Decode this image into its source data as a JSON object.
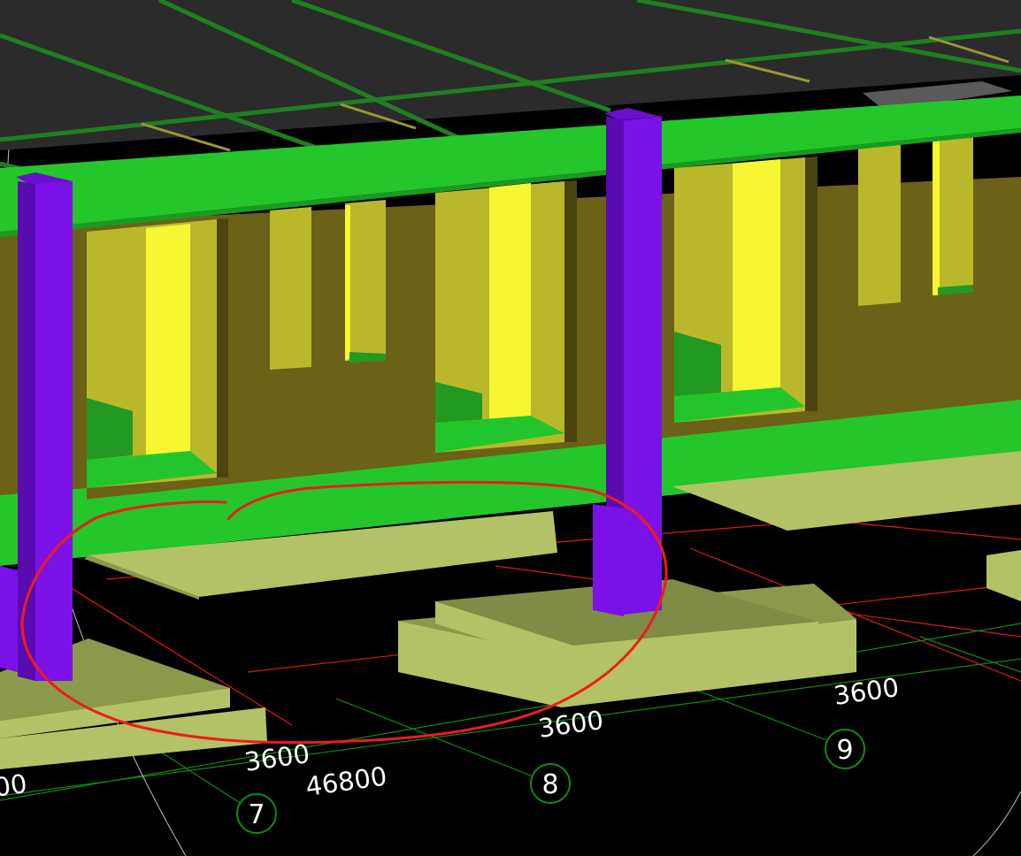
{
  "dimensions": {
    "bay_7_8": "3600",
    "bay_8_9": "3600",
    "bay_9_10": "3600",
    "total": "46800",
    "cut_left": "00"
  },
  "axis_bubbles": {
    "a7": "7",
    "a8": "8",
    "a9": "9"
  },
  "colors": {
    "background": "#000000",
    "slab": "#2c2c2c",
    "beam": "#22c62c",
    "column": "#7a12e8",
    "wall": "#6b6218",
    "window": "#f6f633",
    "footing": "#b3c266",
    "grid_axis": "#118a11",
    "foundation_grid": "#e01818",
    "markup": "#ee1c1c"
  }
}
